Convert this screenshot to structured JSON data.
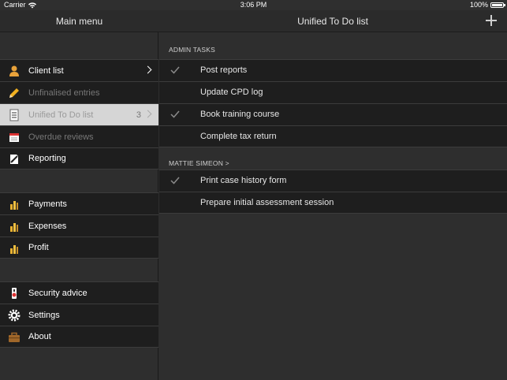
{
  "status_bar": {
    "carrier": "Carrier",
    "time": "3:06 PM",
    "battery": "100%"
  },
  "nav": {
    "left_title": "Main menu",
    "right_title": "Unified To Do list"
  },
  "sidebar": {
    "group1": [
      {
        "label": "Client list",
        "icon": "person-icon",
        "chevron": true
      },
      {
        "label": "Unfinalised entries",
        "icon": "pencil-icon",
        "disabled": true
      },
      {
        "label": "Unified To Do list",
        "icon": "checklist-icon",
        "selected": true,
        "badge": "3"
      },
      {
        "label": "Overdue reviews",
        "icon": "calendar-icon",
        "disabled": true
      },
      {
        "label": "Reporting",
        "icon": "report-icon"
      }
    ],
    "group2": [
      {
        "label": "Payments",
        "icon": "bar-chart-icon"
      },
      {
        "label": "Expenses",
        "icon": "bar-chart-icon"
      },
      {
        "label": "Profit",
        "icon": "bar-chart-icon"
      }
    ],
    "group3": [
      {
        "label": "Security advice",
        "icon": "lock-icon"
      },
      {
        "label": "Settings",
        "icon": "gear-icon"
      },
      {
        "label": "About",
        "icon": "briefcase-icon"
      }
    ]
  },
  "sections": [
    {
      "header": "ADMIN TASKS",
      "tasks": [
        {
          "label": "Post reports",
          "done": true
        },
        {
          "label": "Update CPD log",
          "done": false
        },
        {
          "label": "Book training course",
          "done": true
        },
        {
          "label": "Complete tax return",
          "done": false
        }
      ]
    },
    {
      "header": "MATTIE SIMEON >",
      "tasks": [
        {
          "label": "Print case history form",
          "done": true
        },
        {
          "label": "Prepare initial assessment session",
          "done": false
        }
      ]
    }
  ]
}
